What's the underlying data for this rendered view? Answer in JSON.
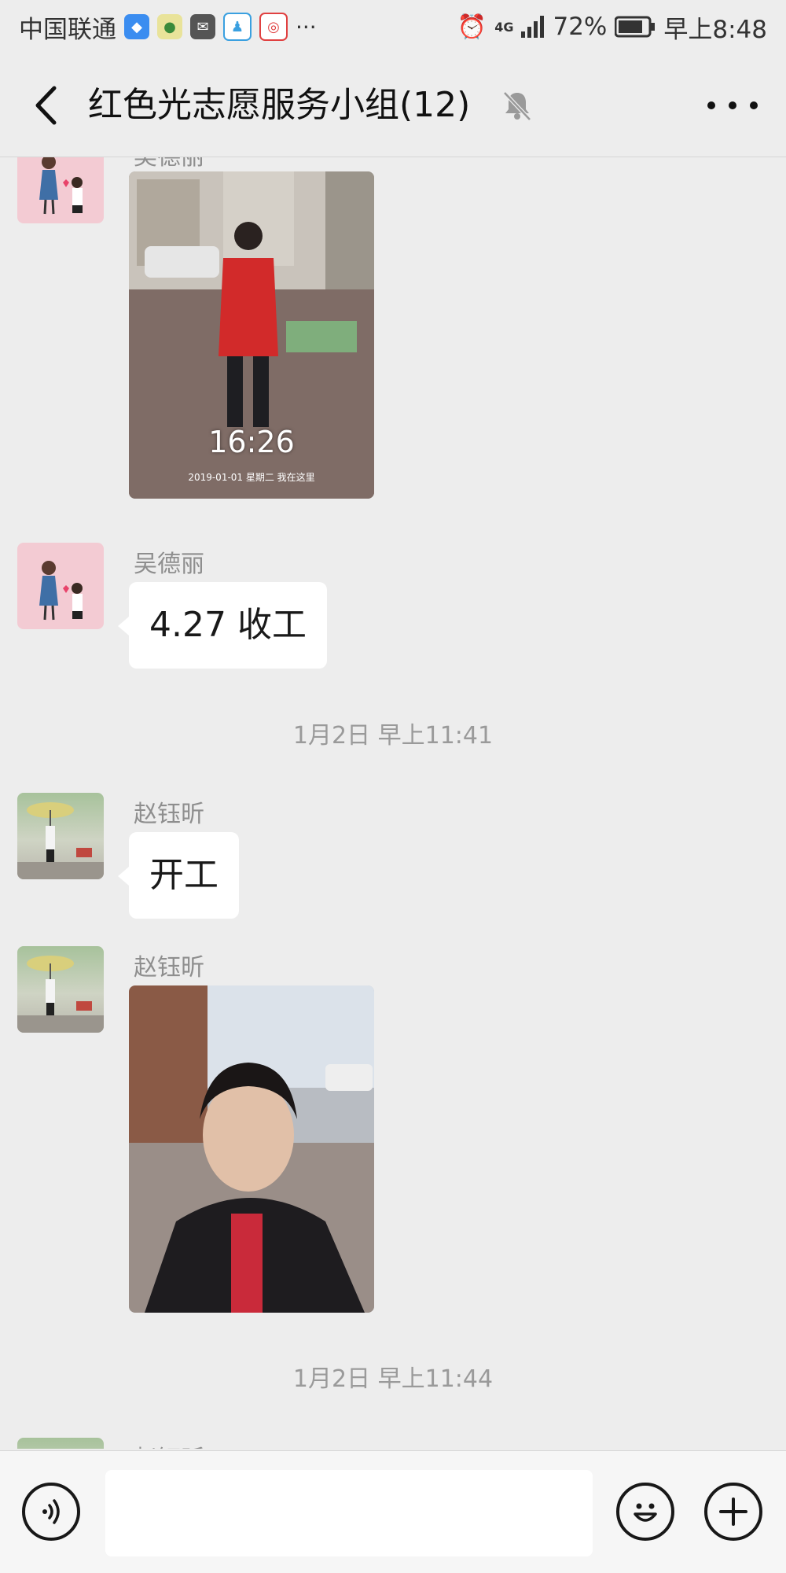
{
  "status_bar": {
    "carrier": "中国联通",
    "network": "4G",
    "battery": "72%",
    "time": "早上8:48"
  },
  "header": {
    "back_icon": "chevron-left-icon",
    "title": "红色光志愿服务小组(12)",
    "muted_icon": "bell-muted-icon",
    "more_icon": "more-dots-icon"
  },
  "messages": [
    {
      "type": "image",
      "sender": "吴德丽",
      "image": "photo-volunteer-red-vest",
      "overlay_time": "16:26",
      "overlay_caption": "2019-01-01  星期二  我在这里"
    },
    {
      "type": "text",
      "sender": "吴德丽",
      "text": "4.27 收工"
    },
    {
      "type": "timestamp",
      "text": "1月2日 早上11:41"
    },
    {
      "type": "text",
      "sender": "赵钰昕",
      "text": "开工"
    },
    {
      "type": "image",
      "sender": "赵钰昕",
      "image": "photo-selfie-outdoors"
    },
    {
      "type": "timestamp",
      "text": "1月2日 早上11:44"
    },
    {
      "type": "partial",
      "sender": "赵钰昕"
    }
  ],
  "input_bar": {
    "voice_icon": "voice-icon",
    "input_value": "",
    "emoji_icon": "emoji-icon",
    "plus_icon": "plus-icon"
  }
}
